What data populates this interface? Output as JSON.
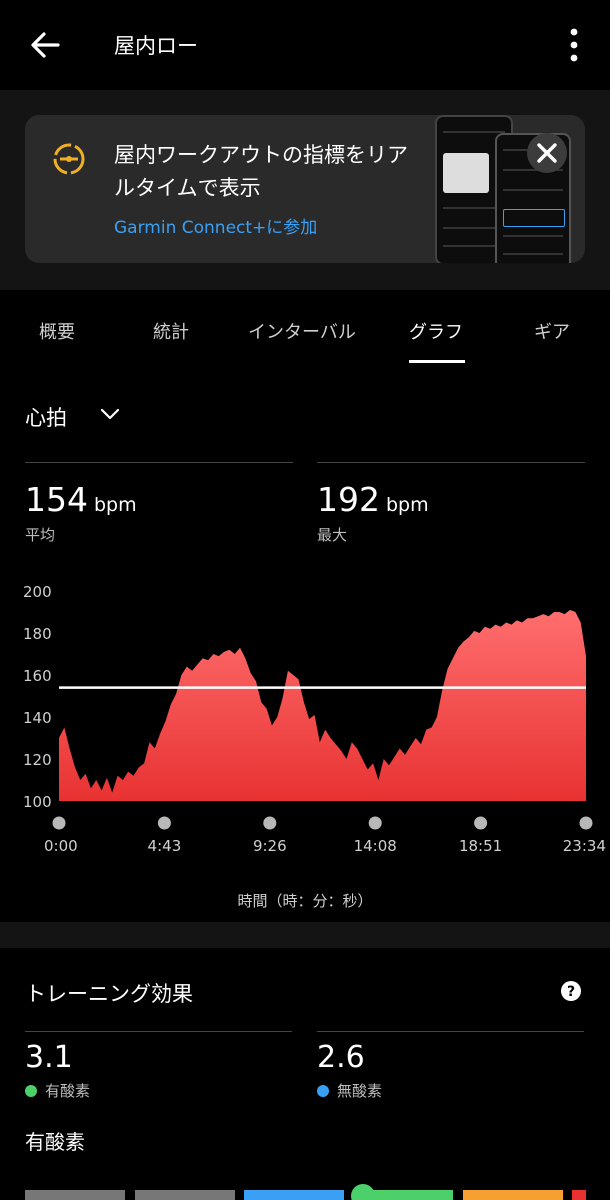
{
  "header": {
    "title": "屋内ロー"
  },
  "promo": {
    "text": "屋内ワークアウトの指標をリアルタイムで表示",
    "link": "Garmin Connect+に参加"
  },
  "tabs": [
    {
      "label": "概要"
    },
    {
      "label": "統計"
    },
    {
      "label": "インターバル"
    },
    {
      "label": "グラフ",
      "active": true
    },
    {
      "label": "ギア"
    }
  ],
  "metric": {
    "label": "心拍"
  },
  "stats": {
    "avg": {
      "value": "154",
      "unit": "bpm",
      "label": "平均"
    },
    "max": {
      "value": "192",
      "unit": "bpm",
      "label": "最大"
    }
  },
  "chart_data": {
    "type": "area",
    "ylim": [
      100,
      200
    ],
    "yticks": [
      "200",
      "180",
      "160",
      "140",
      "120",
      "100"
    ],
    "xticks": [
      "0:00",
      "4:43",
      "9:26",
      "14:08",
      "18:51",
      "23:34"
    ],
    "xlabel": "時間（時：分：秒）",
    "average_line": 154,
    "series": [
      {
        "values": [
          130,
          135,
          125,
          116,
          110,
          113,
          106,
          110,
          105,
          111,
          104,
          112,
          110,
          114,
          112,
          116,
          118,
          128,
          125,
          132,
          138,
          146,
          151,
          160,
          164,
          162,
          165,
          168,
          167,
          170,
          169,
          171,
          172,
          170,
          173,
          168,
          161,
          157,
          147,
          144,
          136,
          140,
          149,
          162,
          160,
          158,
          147,
          139,
          141,
          128,
          134,
          130,
          127,
          124,
          120,
          128,
          125,
          120,
          115,
          118,
          110,
          120,
          117,
          121,
          125,
          122,
          126,
          130,
          127,
          134,
          135,
          140,
          153,
          163,
          168,
          173,
          176,
          178,
          181,
          180,
          183,
          182,
          184,
          183,
          185,
          184,
          186,
          185,
          187,
          187,
          188,
          189,
          188,
          190,
          190,
          189,
          191,
          190,
          185,
          169
        ]
      }
    ],
    "colors": {
      "fill_top": "#ff6e6e",
      "fill_bottom": "#e83232",
      "avg_line": "#ffffff"
    }
  },
  "training_effect": {
    "title": "トレーニング効果",
    "aerobic": {
      "value": "3.1",
      "label": "有酸素",
      "color": "#4cd06a"
    },
    "anaerobic": {
      "value": "2.6",
      "label": "無酸素",
      "color": "#3aa0f5"
    },
    "section_title": "有酸素"
  }
}
